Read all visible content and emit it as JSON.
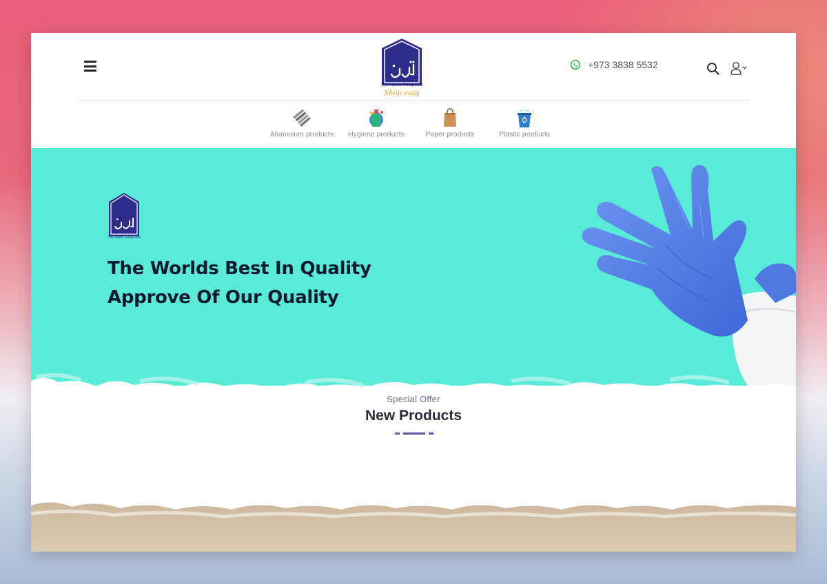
{
  "header": {
    "phone": "+973 3838 5532",
    "logo": {
      "brand_line": "The Home Souq.com",
      "tagline": "Shop easy",
      "arabic_mark": "سوق",
      "color": "#2e2d8c"
    },
    "icons": [
      "hamburger-menu-icon",
      "whatsapp-icon",
      "search-icon",
      "user-icon",
      "chevron-down-icon"
    ]
  },
  "categories": [
    {
      "label": "Aluminium products",
      "icon": "aluminium-foil-icon"
    },
    {
      "label": "Hygiene products",
      "icon": "hygiene-bottle-icon"
    },
    {
      "label": "Paper products",
      "icon": "paper-bag-icon"
    },
    {
      "label": "Plastic products",
      "icon": "plastic-bin-icon"
    }
  ],
  "hero": {
    "line1": "The Worlds Best In Quality",
    "line2": "Approve Of Our Quality",
    "background": "#5aead8",
    "glove_color": "#5b86ee"
  },
  "section": {
    "eyebrow": "Special Offer",
    "title": "New Products",
    "accent": "#5c54a4"
  }
}
